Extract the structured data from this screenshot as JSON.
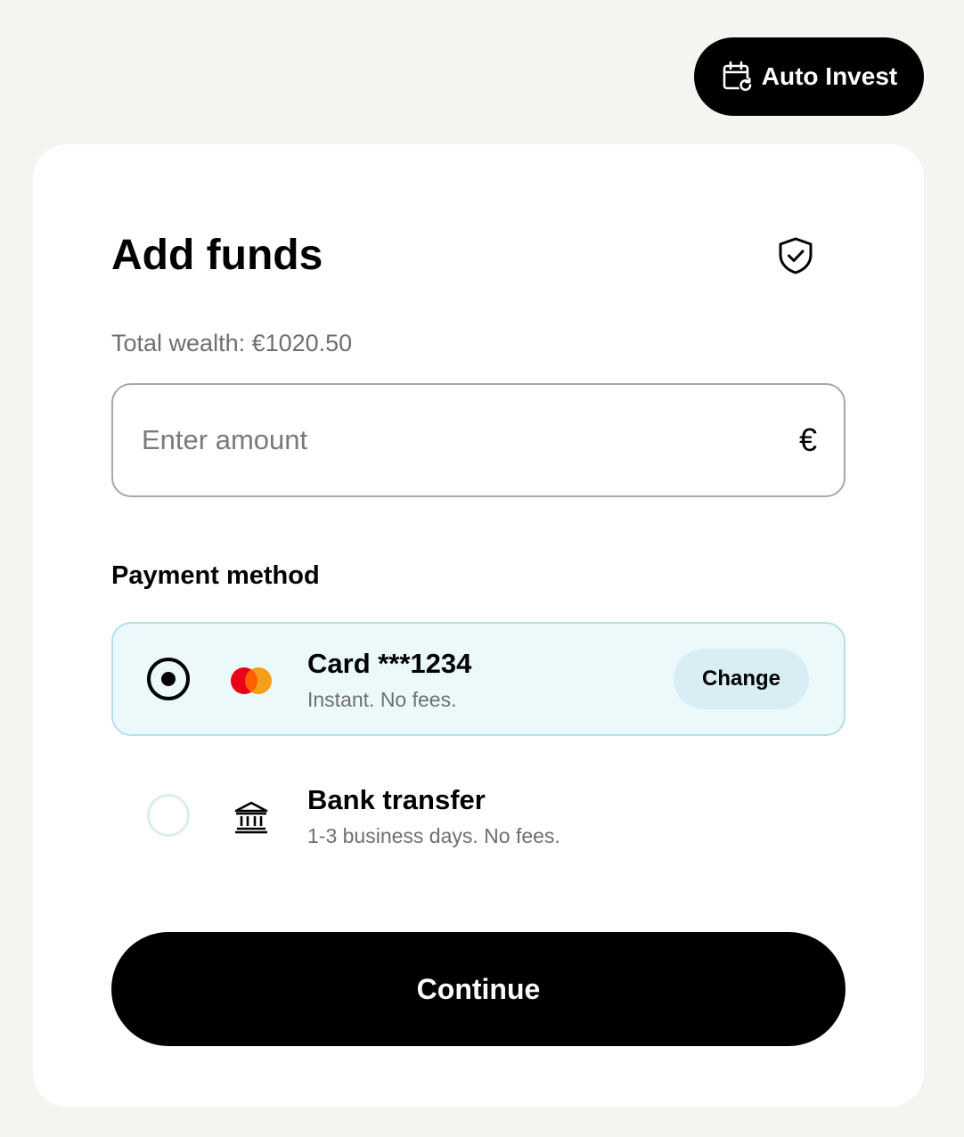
{
  "header": {
    "auto_invest_label": "Auto Invest",
    "auto_invest_icon": "calendar-repeat-icon"
  },
  "panel": {
    "title": "Add funds",
    "shield_icon": "shield-check-icon",
    "wealth_text": "Total wealth: €1020.50",
    "amount": {
      "placeholder": "Enter amount",
      "value": "",
      "currency_symbol": "€"
    },
    "payment_section_label": "Payment method",
    "methods": [
      {
        "title": "Card ***1234",
        "subtitle": "Instant. No fees.",
        "icon": "mastercard-icon",
        "selected": true,
        "action_label": "Change"
      },
      {
        "title": "Bank transfer",
        "subtitle": "1-3 business days. No fees.",
        "icon": "bank-icon",
        "selected": false
      }
    ],
    "continue_label": "Continue"
  },
  "colors": {
    "page_background": "#f5f4f0",
    "card_background": "#ffffff",
    "primary_button": "#000000",
    "selected_method_background": "#ebf9fb",
    "selected_method_border": "#b8dfe9",
    "change_button_background": "#d9eef4",
    "mastercard_red": "#eb001b",
    "mastercard_orange": "#f79e1b"
  }
}
